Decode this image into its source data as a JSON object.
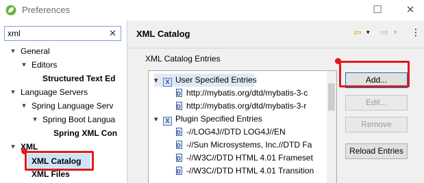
{
  "window": {
    "title": "Preferences"
  },
  "filter": {
    "value": "xml",
    "clear_glyph": "✕"
  },
  "tree": {
    "items": [
      {
        "label": "General",
        "twisty": "▾"
      },
      {
        "label": "Editors",
        "twisty": "▾"
      },
      {
        "label": "Structured Text Ed"
      },
      {
        "label": "Language Servers",
        "twisty": "▾"
      },
      {
        "label": "Spring Language Serv",
        "twisty": "▾"
      },
      {
        "label": "Spring Boot Langua",
        "twisty": "▾"
      },
      {
        "label": "Spring XML Con"
      },
      {
        "label": "XML",
        "twisty": "▾"
      },
      {
        "label": "XML Catalog"
      },
      {
        "label": "XML Files"
      }
    ]
  },
  "page": {
    "title": "XML Catalog",
    "nav_back": "⇦",
    "nav_forward": "⇨",
    "menu": "⋮",
    "group_label": "XML Catalog Entries"
  },
  "entries": [
    {
      "label": "User Specified Entries"
    },
    {
      "label": "http://mybatis.org/dtd/mybatis-3-c"
    },
    {
      "label": "http://mybatis.org/dtd/mybatis-3-r"
    },
    {
      "label": "Plugin Specified Entries"
    },
    {
      "label": "-//LOG4J//DTD LOG4J//EN"
    },
    {
      "label": "-//Sun Microsystems, Inc.//DTD Fa"
    },
    {
      "label": "-//W3C//DTD HTML 4.01 Frameset"
    },
    {
      "label": "-//W3C//DTD HTML 4.01 Transition"
    }
  ],
  "buttons": {
    "add": "Add...",
    "edit": "Edit...",
    "remove": "Remove",
    "reload": "Reload Entries"
  },
  "colors": {
    "highlight": "#e0181c",
    "selection": "#cce4f7"
  }
}
